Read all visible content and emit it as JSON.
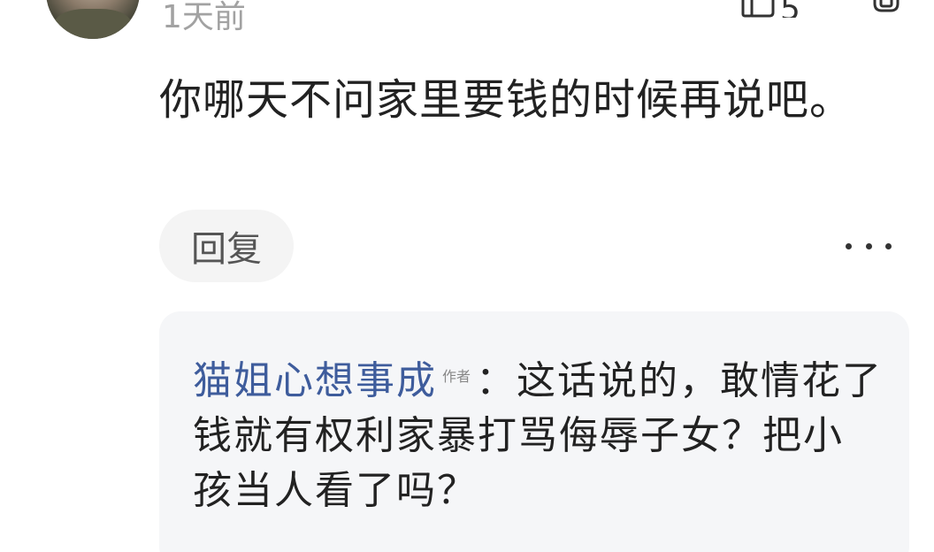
{
  "comment": {
    "time": "1天前",
    "like_count": "5",
    "text": "你哪天不问家里要钱的时候再说吧。",
    "reply_label": "回复"
  },
  "reply": {
    "author": "猫姐心想事成",
    "author_badge": "作者",
    "separator": "：",
    "text": "这话说的，敢情花了钱就有权利家暴打骂侮辱子女？把小孩当人看了吗？"
  },
  "colors": {
    "author_link": "#3e5c9c",
    "timestamp": "#a2a2a2",
    "reply_box_bg": "#f5f6f8",
    "reply_button_bg": "#f4f4f4"
  },
  "icons": {
    "like": "thumbs-up-icon",
    "dislike": "thumbs-down-icon",
    "more": "more-dots-icon"
  }
}
